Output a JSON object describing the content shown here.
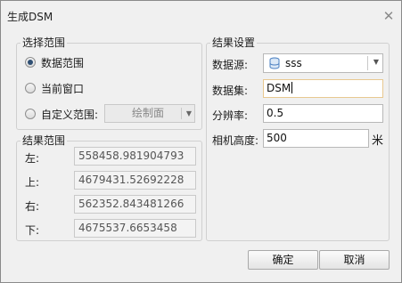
{
  "window": {
    "title": "生成DSM",
    "close_glyph": "✕"
  },
  "selection_range": {
    "legend": "选择范围",
    "options": [
      {
        "label": "数据范围",
        "checked": true
      },
      {
        "label": "当前窗口",
        "checked": false
      },
      {
        "label": "自定义范围:",
        "checked": false
      }
    ],
    "draw_button": {
      "label": "绘制面",
      "enabled": false
    }
  },
  "result_range": {
    "legend": "结果范围",
    "fields": [
      {
        "label": "左:",
        "value": "558458.981904793"
      },
      {
        "label": "上:",
        "value": "4679431.52692228"
      },
      {
        "label": "右:",
        "value": "562352.843481266"
      },
      {
        "label": "下:",
        "value": "4675537.6653458"
      }
    ]
  },
  "result_settings": {
    "legend": "结果设置",
    "datasource": {
      "label": "数据源:",
      "value": "sss",
      "icon": "database-icon"
    },
    "dataset": {
      "label": "数据集:",
      "value": "DSM"
    },
    "resolution": {
      "label": "分辨率:",
      "value": "0.5"
    },
    "camera_height": {
      "label": "相机高度:",
      "value": "500",
      "unit": "米"
    }
  },
  "buttons": {
    "ok": "确定",
    "cancel": "取消"
  },
  "colors": {
    "focus_border": "#e8c890",
    "radio_dot": "#2f4f73",
    "db_icon": "#4a7fc0"
  }
}
